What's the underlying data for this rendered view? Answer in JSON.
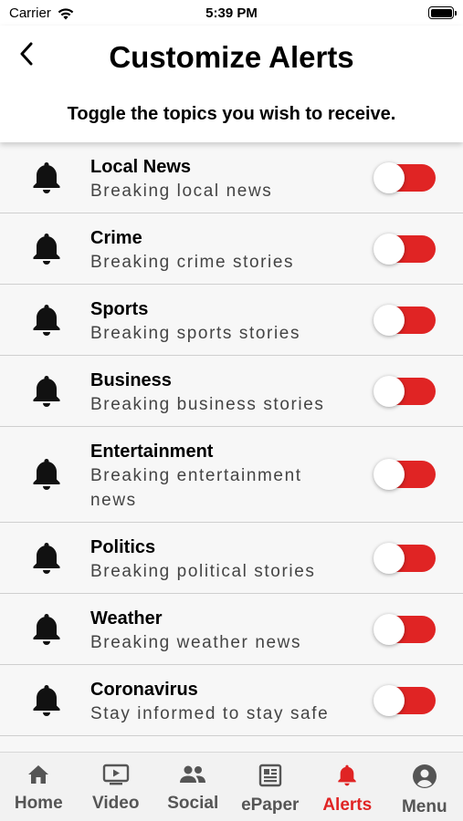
{
  "status_bar": {
    "carrier": "Carrier",
    "time": "5:39 PM"
  },
  "header": {
    "title": "Customize Alerts",
    "subtitle": "Toggle the topics you wish to receive."
  },
  "topics": [
    {
      "title": "Local News",
      "description": "Breaking local news",
      "enabled": false
    },
    {
      "title": "Crime",
      "description": "Breaking crime stories",
      "enabled": false
    },
    {
      "title": "Sports",
      "description": "Breaking sports stories",
      "enabled": false
    },
    {
      "title": "Business",
      "description": "Breaking business stories",
      "enabled": false
    },
    {
      "title": "Entertainment",
      "description": "Breaking entertainment news",
      "enabled": false
    },
    {
      "title": "Politics",
      "description": "Breaking political stories",
      "enabled": false
    },
    {
      "title": "Weather",
      "description": "Breaking weather news",
      "enabled": false
    },
    {
      "title": "Coronavirus",
      "description": "Stay informed to stay safe",
      "enabled": false
    }
  ],
  "tabbar": {
    "tabs": [
      {
        "label": "Home",
        "icon": "home-icon"
      },
      {
        "label": "Video",
        "icon": "video-icon"
      },
      {
        "label": "Social",
        "icon": "people-icon"
      },
      {
        "label": "ePaper",
        "icon": "newspaper-icon"
      },
      {
        "label": "Alerts",
        "icon": "bell-icon",
        "active": true
      },
      {
        "label": "Menu",
        "icon": "account-icon"
      }
    ]
  },
  "colors": {
    "accent": "#e02424",
    "inactive_tab": "#555555",
    "list_background": "#f7f7f7"
  }
}
